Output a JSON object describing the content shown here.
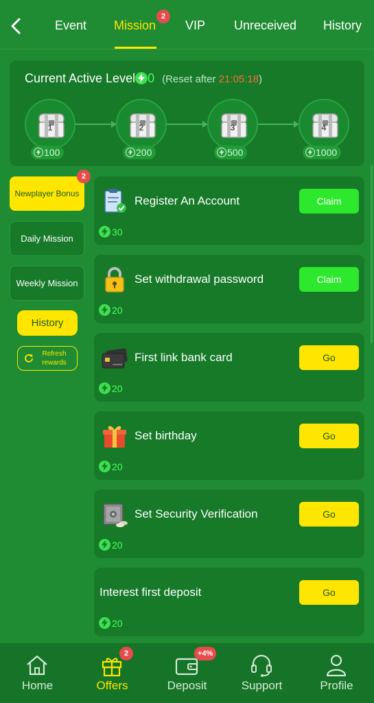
{
  "tabs": [
    {
      "label": "Event"
    },
    {
      "label": "Mission",
      "badge": "2"
    },
    {
      "label": "VIP"
    },
    {
      "label": "Unreceived"
    },
    {
      "label": "History"
    }
  ],
  "level": {
    "title": "Current Active Level",
    "value": "0",
    "reset_prefix": "(Reset after ",
    "reset_time": "21:05:18",
    "reset_suffix": ")",
    "chests": [
      {
        "num": "1",
        "points": "100"
      },
      {
        "num": "2",
        "points": "200"
      },
      {
        "num": "3",
        "points": "500"
      },
      {
        "num": "4",
        "points": "1000"
      }
    ]
  },
  "side_menu": {
    "newplayer": "Newplayer Bonus",
    "newplayer_badge": "2",
    "daily": "Daily Mission",
    "weekly": "Weekly Mission",
    "history": "History",
    "refresh": "Refresh rewards"
  },
  "missions": [
    {
      "title": "Register An Account",
      "reward": "30",
      "action": "Claim",
      "icon": "clipboard-check-icon"
    },
    {
      "title": "Set withdrawal password",
      "reward": "20",
      "action": "Claim",
      "icon": "padlock-icon"
    },
    {
      "title": "First link bank card",
      "reward": "20",
      "action": "Go",
      "icon": "bank-card-icon"
    },
    {
      "title": "Set birthday",
      "reward": "20",
      "action": "Go",
      "icon": "gift-box-icon"
    },
    {
      "title": "Set Security Verification",
      "reward": "20",
      "action": "Go",
      "icon": "safe-icon"
    },
    {
      "title": "Interest first deposit",
      "reward": "20",
      "action": "Go",
      "icon": ""
    }
  ],
  "bottom_nav": {
    "home": "Home",
    "offers": "Offers",
    "offers_badge": "2",
    "deposit": "Deposit",
    "deposit_badge": "+4%",
    "support": "Support",
    "profile": "Profile"
  },
  "colors": {
    "background": "#1f8c33",
    "panel": "#167a29",
    "accent_yellow": "#ffe600",
    "claim_green": "#2ee82e",
    "badge_red": "#e74c4c"
  }
}
